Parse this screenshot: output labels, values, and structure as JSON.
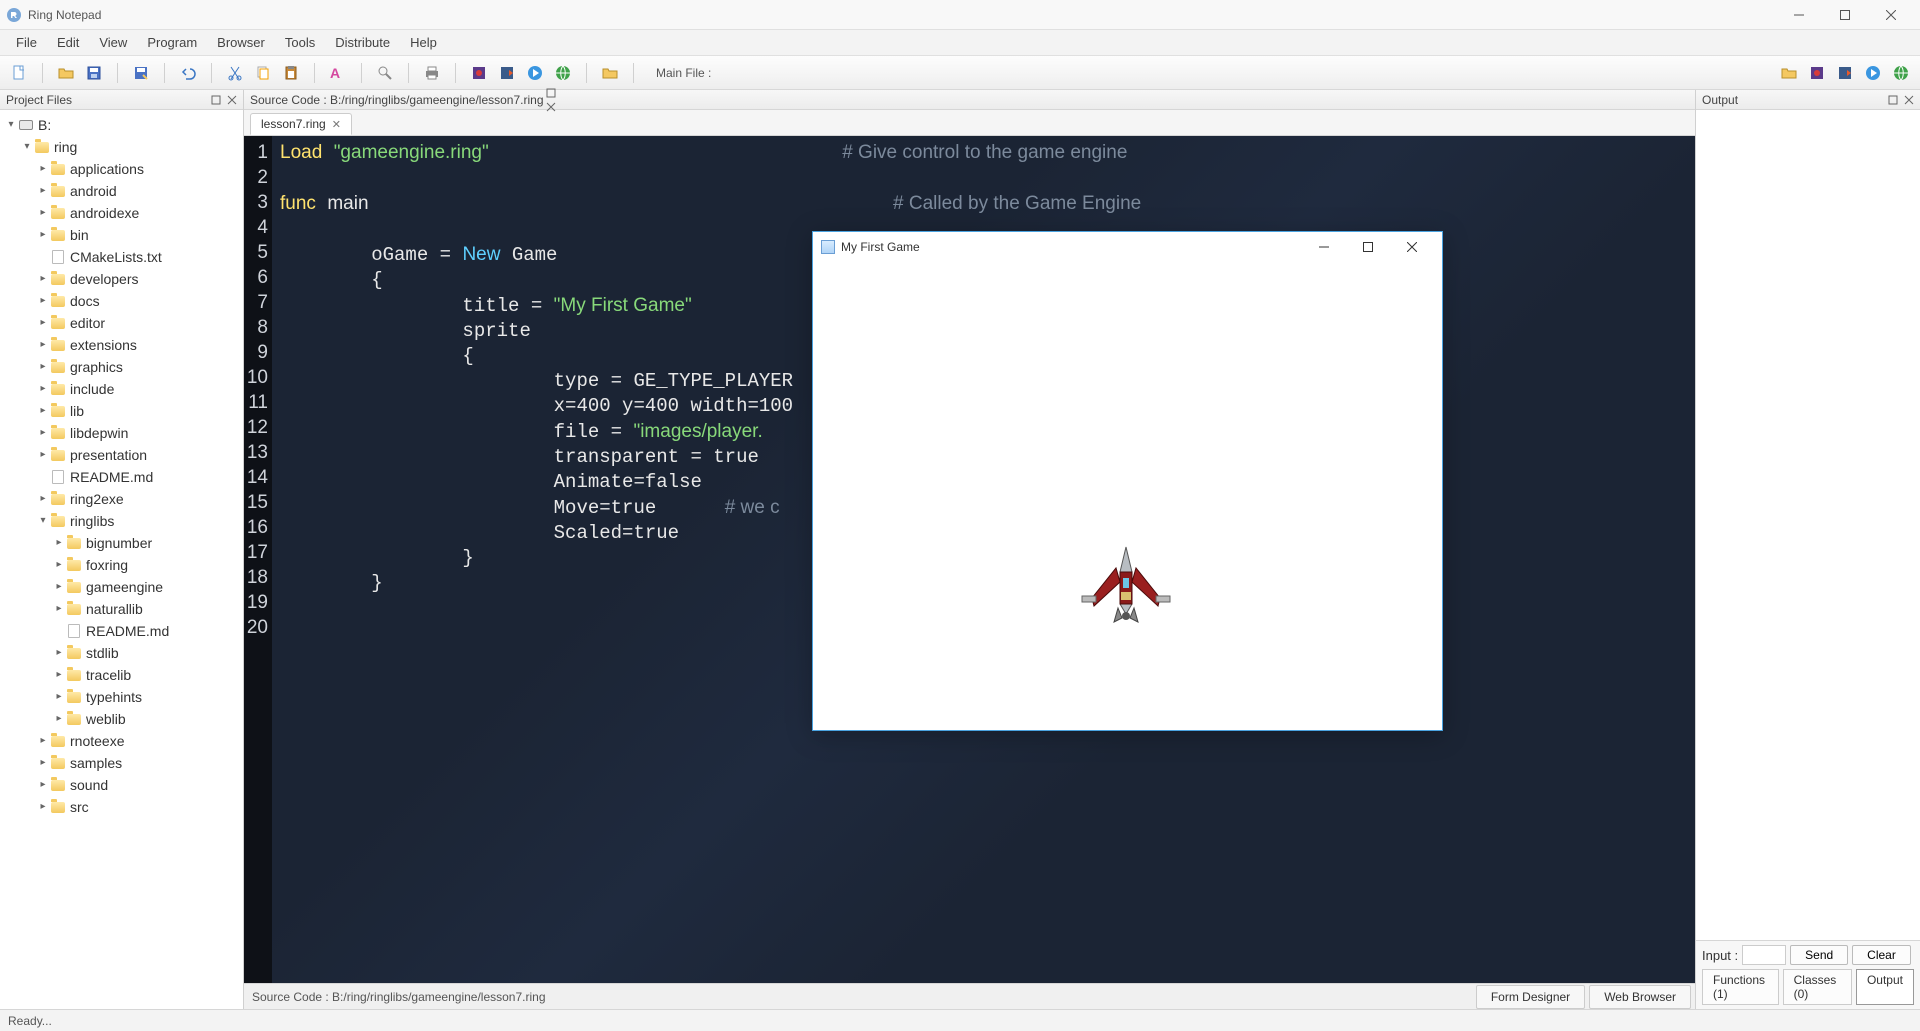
{
  "app": {
    "title": "Ring Notepad",
    "status": "Ready..."
  },
  "menu": [
    "File",
    "Edit",
    "View",
    "Program",
    "Browser",
    "Tools",
    "Distribute",
    "Help"
  ],
  "toolbar": {
    "main_file_label": "Main File :"
  },
  "project": {
    "title": "Project Files",
    "root": "B:",
    "root_folder": "ring",
    "items_level1": [
      {
        "label": "applications",
        "type": "folder"
      },
      {
        "label": "android",
        "type": "folder"
      },
      {
        "label": "androidexe",
        "type": "folder"
      },
      {
        "label": "bin",
        "type": "folder"
      },
      {
        "label": "CMakeLists.txt",
        "type": "file"
      },
      {
        "label": "developers",
        "type": "folder"
      },
      {
        "label": "docs",
        "type": "folder"
      },
      {
        "label": "editor",
        "type": "folder"
      },
      {
        "label": "extensions",
        "type": "folder"
      },
      {
        "label": "graphics",
        "type": "folder"
      },
      {
        "label": "include",
        "type": "folder"
      },
      {
        "label": "lib",
        "type": "folder"
      },
      {
        "label": "libdepwin",
        "type": "folder"
      },
      {
        "label": "presentation",
        "type": "folder"
      },
      {
        "label": "README.md",
        "type": "file"
      },
      {
        "label": "ring2exe",
        "type": "folder"
      }
    ],
    "ringlibs": {
      "label": "ringlibs",
      "children": [
        {
          "label": "bignumber",
          "type": "folder"
        },
        {
          "label": "foxring",
          "type": "folder"
        },
        {
          "label": "gameengine",
          "type": "folder"
        },
        {
          "label": "naturallib",
          "type": "folder"
        },
        {
          "label": "README.md",
          "type": "file"
        },
        {
          "label": "stdlib",
          "type": "folder"
        },
        {
          "label": "tracelib",
          "type": "folder"
        },
        {
          "label": "typehints",
          "type": "folder"
        },
        {
          "label": "weblib",
          "type": "folder"
        }
      ]
    },
    "items_after": [
      {
        "label": "rnoteexe",
        "type": "folder"
      },
      {
        "label": "samples",
        "type": "folder"
      },
      {
        "label": "sound",
        "type": "folder"
      },
      {
        "label": "src",
        "type": "folder"
      }
    ]
  },
  "editor": {
    "header": "Source Code : B:/ring/ringlibs/gameengine/lesson7.ring",
    "tab": "lesson7.ring",
    "bottom_path": "Source Code : B:/ring/ringlibs/gameengine/lesson7.ring",
    "bottom_tabs": [
      "Form Designer",
      "Web Browser"
    ],
    "lines": [
      1,
      2,
      3,
      4,
      5,
      6,
      7,
      8,
      9,
      10,
      11,
      12,
      13,
      14,
      15,
      16,
      17,
      18,
      19,
      20
    ]
  },
  "code": {
    "l1_kw": "Load",
    "l1_str": "\"gameengine.ring\"",
    "l1_cm": "# Give control to the game engine",
    "l3_kw": "func",
    "l3_id": "main",
    "l3_cm": "# Called by the Game Engine",
    "l5_a": "oGame = ",
    "l5_new": "New",
    "l5_b": " Game",
    "l6": "{",
    "l7_a": "title = ",
    "l7_str": "\"My First Game\"",
    "l8": "sprite",
    "l9": "{",
    "l10": "type = GE_TYPE_PLAYER",
    "l11": "x=400 y=400 width=100 ",
    "l12_a": "file = ",
    "l12_str": "\"images/player.",
    "l13": "transparent = true",
    "l14": "Animate=false",
    "l15_a": "Move=true",
    "l15_cm": "# we c",
    "l16": "Scaled=true",
    "l17": "}",
    "l18": "}"
  },
  "output": {
    "title": "Output",
    "input_label": "Input :",
    "send": "Send",
    "clear": "Clear",
    "tabs": {
      "functions": "Functions (1)",
      "classes": "Classes (0)",
      "output": "Output"
    }
  },
  "game": {
    "title": "My First Game"
  }
}
